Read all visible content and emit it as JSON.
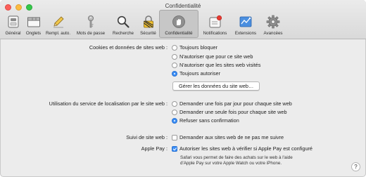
{
  "window": {
    "title": "Confidentialité"
  },
  "toolbar": {
    "items": [
      {
        "label": "Général",
        "icon": "general-switch-icon"
      },
      {
        "label": "Onglets",
        "icon": "tabs-icon"
      },
      {
        "label": "Rempl. auto.",
        "icon": "pencil-icon"
      },
      {
        "label": "Mots de passe",
        "icon": "key-icon"
      },
      {
        "label": "Recherche",
        "icon": "magnifier-icon"
      },
      {
        "label": "Sécurité",
        "icon": "padlock-icon"
      },
      {
        "label": "Confidentialité",
        "icon": "hand-icon",
        "selected": true
      },
      {
        "label": "Notifications",
        "icon": "notifications-icon"
      },
      {
        "label": "Extensions",
        "icon": "puzzle-icon"
      },
      {
        "label": "Avancées",
        "icon": "gear-icon"
      }
    ]
  },
  "cookies": {
    "label": "Cookies et données de sites web :",
    "options": [
      "Toujours bloquer",
      "N'autoriser que pour ce site web",
      "N'autoriser que les sites web visités",
      "Toujours autoriser"
    ],
    "selected": 3,
    "manage_button": "Gérer les données du site web…"
  },
  "location": {
    "label": "Utilisation du service de localisation par le site web :",
    "options": [
      "Demander une fois par jour pour chaque site web",
      "Demander une seule fois pour chaque site web",
      "Refuser sans confirmation"
    ],
    "selected": 2
  },
  "tracking": {
    "label": "Suivi de site web :",
    "checkbox_label": "Demander aux sites web de ne pas me suivre",
    "checked": false
  },
  "applepay": {
    "label": "Apple Pay :",
    "checkbox_label": "Autoriser les sites web à vérifier si Apple Pay est configuré",
    "checked": true,
    "hint_line1": "Safari vous permet de faire des achats sur le web à l'aide",
    "hint_line2": "d'Apple Pay sur votre Apple Watch ou votre iPhone."
  },
  "help": {
    "label": "?"
  },
  "colors": {
    "accent": "#3a8ef6",
    "toolbar_selected": "#c7c7c7",
    "background": "#ececec"
  }
}
